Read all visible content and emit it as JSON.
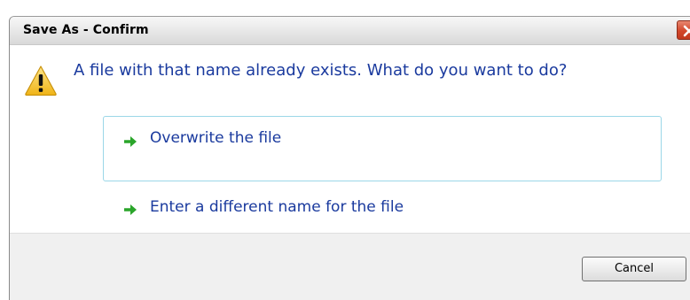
{
  "window": {
    "title": "Save As - Confirm"
  },
  "dialog": {
    "message": "A file with that name already exists. What do you want to do?",
    "options": [
      {
        "label": "Overwrite the file",
        "icon": "green-arrow-right-icon",
        "selected": true
      },
      {
        "label": "Enter a different name for the file",
        "icon": "green-arrow-right-icon",
        "selected": false
      }
    ],
    "cancel_label": "Cancel"
  },
  "icons": {
    "warning": "warning-triangle-icon",
    "close": "close-icon"
  },
  "colors": {
    "link_text": "#1a3a9e",
    "arrow": "#2aa52a",
    "warning_fill": "#f4c430",
    "close_button": "#d2472b",
    "selection_border": "#9bd7e8",
    "footer_bg": "#f0f0f0"
  }
}
